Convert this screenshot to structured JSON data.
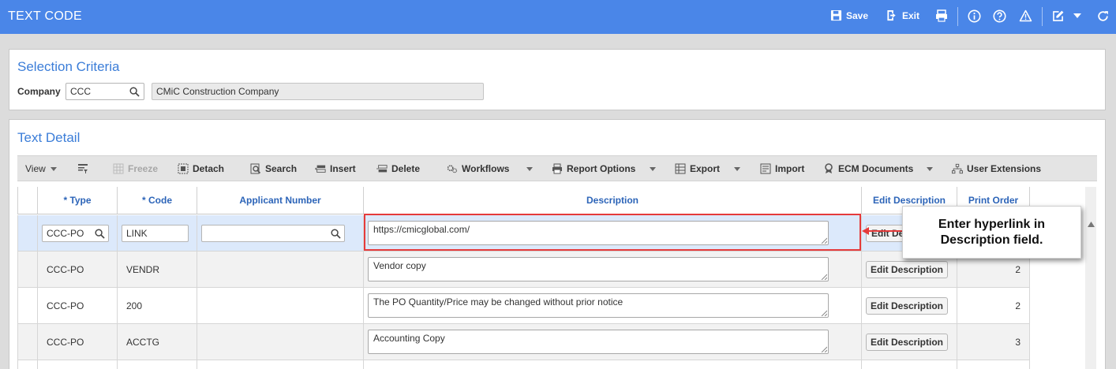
{
  "header": {
    "title": "TEXT CODE",
    "save_label": "Save",
    "exit_label": "Exit"
  },
  "selection": {
    "title": "Selection Criteria",
    "company_label": "Company",
    "company_value": "CCC",
    "company_name": "CMiC Construction Company"
  },
  "detail": {
    "title": "Text Detail"
  },
  "toolbar": {
    "view": "View",
    "freeze": "Freeze",
    "detach": "Detach",
    "search": "Search",
    "insert": "Insert",
    "delete": "Delete",
    "workflows": "Workflows",
    "report_options": "Report Options",
    "export": "Export",
    "import": "Import",
    "ecm_documents": "ECM Documents",
    "user_extensions": "User Extensions"
  },
  "table": {
    "columns": [
      "* Type",
      "* Code",
      "Applicant Number",
      "Description",
      "Edit Description",
      "Print Order"
    ],
    "edit_button_label": "Edit Description",
    "rows": [
      {
        "type": "CCC-PO",
        "code": "LINK",
        "applicant": "",
        "description": "https://cmicglobal.com/",
        "print_order": ""
      },
      {
        "type": "CCC-PO",
        "code": "VENDR",
        "applicant": "",
        "description": "Vendor copy",
        "print_order": "2"
      },
      {
        "type": "CCC-PO",
        "code": "200",
        "applicant": "",
        "description": "The PO Quantity/Price may be changed without prior notice",
        "print_order": "2"
      },
      {
        "type": "CCC-PO",
        "code": "ACCTG",
        "applicant": "",
        "description": "Accounting Copy",
        "print_order": "3"
      }
    ],
    "edit_button_partial": "Edit De"
  },
  "callout": {
    "text": "Enter hyperlink in Description field."
  }
}
